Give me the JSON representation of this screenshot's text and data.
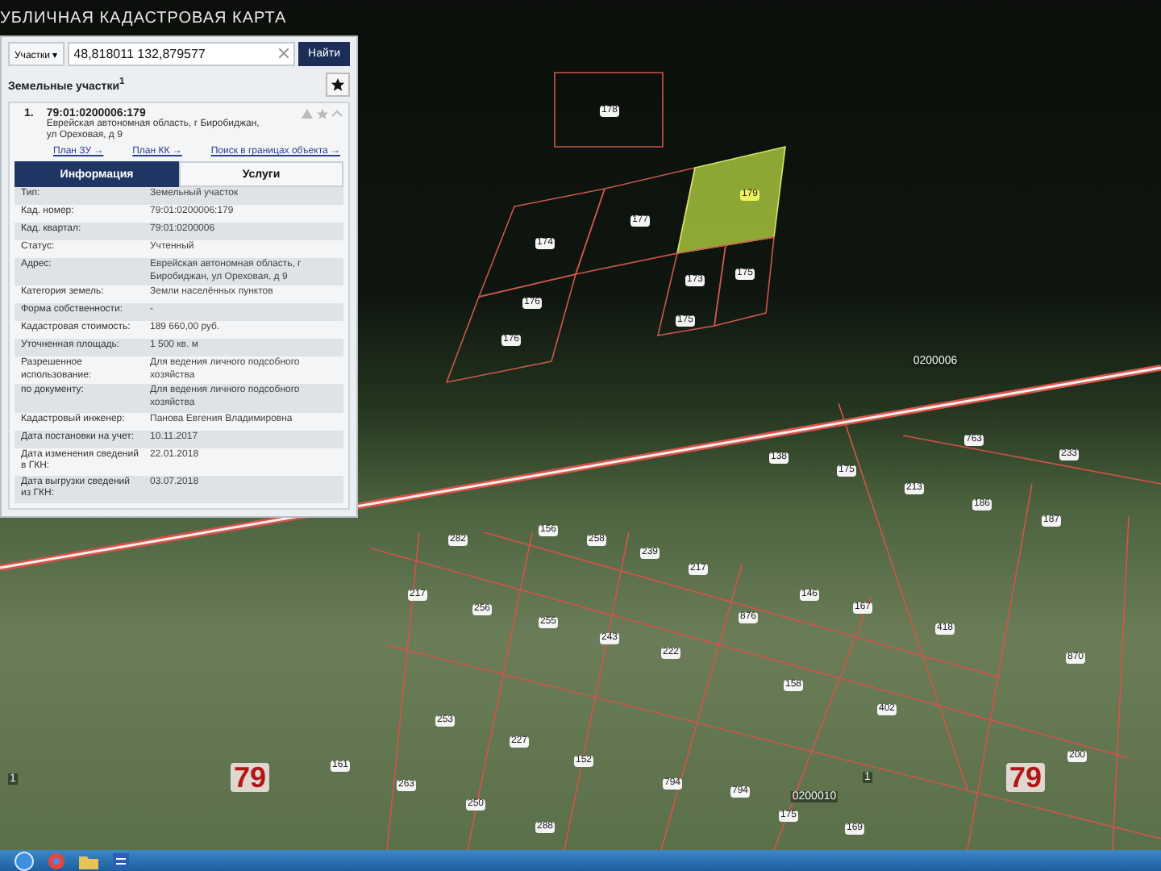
{
  "app_title": "УБЛИЧНАЯ КАДАСТРОВАЯ КАРТА",
  "search": {
    "category": "Участки",
    "caret": "▾",
    "value": "48,818011 132,879577",
    "button": "Найти"
  },
  "results_header": {
    "title": "Земельные участки",
    "count": "1"
  },
  "result": {
    "number": "1.",
    "cad_number": "79:01:0200006:179",
    "address": "Еврейская автономная область, г Биробиджан, ул Ореховая, д 9",
    "links": [
      "План ЗУ →",
      "План КК →",
      "Поиск в границах объекта →"
    ]
  },
  "tabs": [
    {
      "label": "Информация",
      "selected": true
    },
    {
      "label": "Услуги",
      "selected": false
    }
  ],
  "attributes": [
    {
      "label": "Тип:",
      "value": "Земельный участок"
    },
    {
      "label": "Кад. номер:",
      "value": "79:01:0200006:179"
    },
    {
      "label": "Кад. квартал:",
      "value": "79:01:0200006"
    },
    {
      "label": "Статус:",
      "value": "Учтенный"
    },
    {
      "label": "Адрес:",
      "value": "Еврейская автономная область, г Биробиджан, ул Ореховая, д 9"
    },
    {
      "label": "Категория земель:",
      "value": "Земли населённых пунктов"
    },
    {
      "label": "Форма собственности:",
      "value": "-"
    },
    {
      "label": "Кадастровая стоимость:",
      "value": "189 660,00 руб."
    },
    {
      "label": "Уточненная площадь:",
      "value": "1 500 кв. м"
    },
    {
      "label": "Разрешенное использование:",
      "value": "Для ведения личного подсобного хозяйства"
    },
    {
      "label": "по документу:",
      "value": "Для ведения личного подсобного хозяйства"
    },
    {
      "label": "Кадастровый инженер:",
      "value": "Панова Евгения Владимировна"
    },
    {
      "label": "Дата постановки на учет:",
      "value": "10.11.2017"
    },
    {
      "label": "Дата изменения сведений в ГКН:",
      "value": "22.01.2018"
    },
    {
      "label": "Дата выгрузки сведений из ГКН:",
      "value": "03.07.2018"
    }
  ],
  "parcels": [
    {
      "label": "178",
      "selected": false
    },
    {
      "label": "177",
      "selected": false
    },
    {
      "label": "179",
      "selected": true
    },
    {
      "label": "174",
      "selected": false
    },
    {
      "label": "176",
      "selected": false
    },
    {
      "label": "173",
      "selected": false
    },
    {
      "label": "175",
      "selected": false
    }
  ],
  "map_labels": [
    {
      "text": "176",
      "kind": "number"
    },
    {
      "text": "175",
      "kind": "number"
    },
    {
      "text": "0200006",
      "kind": "block"
    },
    {
      "text": "138",
      "kind": "number"
    },
    {
      "text": "175",
      "kind": "number"
    },
    {
      "text": "763",
      "kind": "number"
    },
    {
      "text": "213",
      "kind": "number"
    },
    {
      "text": "186",
      "kind": "number"
    },
    {
      "text": "233",
      "kind": "number"
    },
    {
      "text": "187",
      "kind": "number"
    },
    {
      "text": "282",
      "kind": "number"
    },
    {
      "text": "156",
      "kind": "number"
    },
    {
      "text": "258",
      "kind": "number"
    },
    {
      "text": "239",
      "kind": "number"
    },
    {
      "text": "217",
      "kind": "number"
    },
    {
      "text": "217",
      "kind": "number"
    },
    {
      "text": "256",
      "kind": "number"
    },
    {
      "text": "255",
      "kind": "number"
    },
    {
      "text": "243",
      "kind": "number"
    },
    {
      "text": "222",
      "kind": "number"
    },
    {
      "text": "876",
      "kind": "number"
    },
    {
      "text": "146",
      "kind": "number"
    },
    {
      "text": "167",
      "kind": "number"
    },
    {
      "text": "418",
      "kind": "number"
    },
    {
      "text": "870",
      "kind": "number"
    },
    {
      "text": "158",
      "kind": "number"
    },
    {
      "text": "402",
      "kind": "number"
    },
    {
      "text": "253",
      "kind": "number"
    },
    {
      "text": "227",
      "kind": "number"
    },
    {
      "text": "152",
      "kind": "number"
    },
    {
      "text": "200",
      "kind": "number"
    },
    {
      "text": "1",
      "kind": "block"
    },
    {
      "text": "79",
      "kind": "quarter"
    },
    {
      "text": "161",
      "kind": "number"
    },
    {
      "text": "263",
      "kind": "number"
    },
    {
      "text": "794",
      "kind": "number"
    },
    {
      "text": "794",
      "kind": "number"
    },
    {
      "text": "0200010",
      "kind": "block"
    },
    {
      "text": "1",
      "kind": "block"
    },
    {
      "text": "79",
      "kind": "quarter"
    },
    {
      "text": "250",
      "kind": "number"
    },
    {
      "text": "288",
      "kind": "number"
    },
    {
      "text": "175",
      "kind": "number"
    },
    {
      "text": "169",
      "kind": "number"
    }
  ]
}
